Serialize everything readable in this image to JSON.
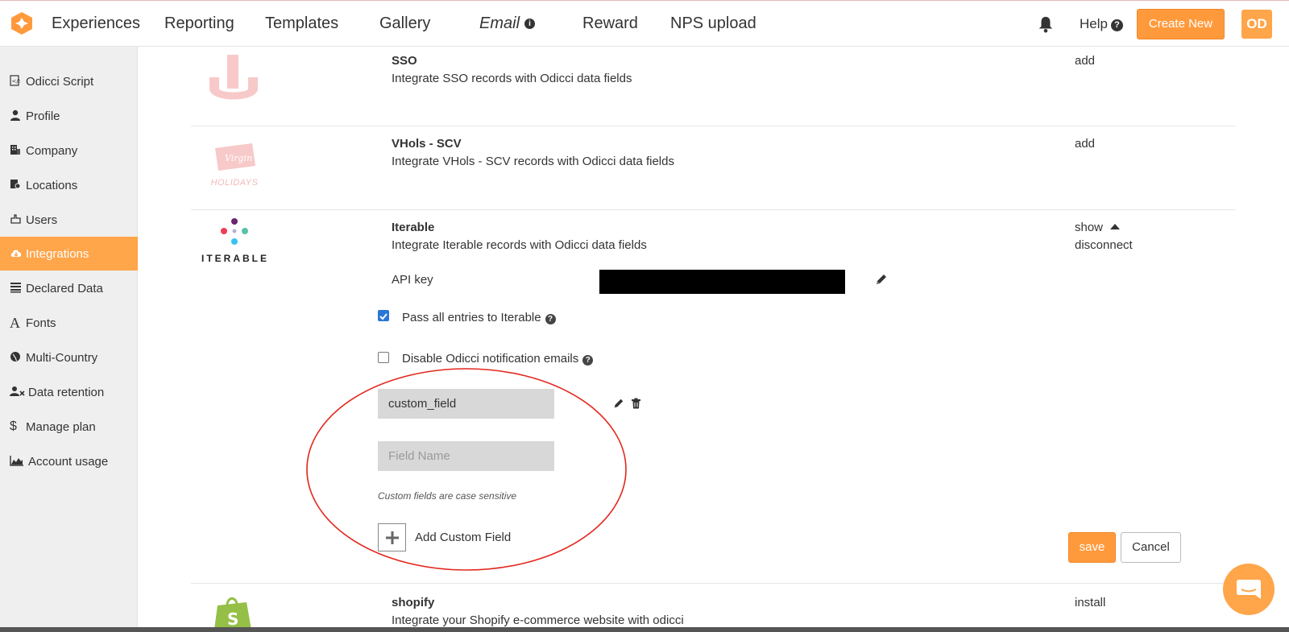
{
  "nav": {
    "items": [
      "Experiences",
      "Reporting",
      "Templates",
      "Gallery",
      "Email",
      "Reward",
      "NPS upload"
    ],
    "email_info_icon": "info-icon",
    "help_label": "Help",
    "create_new_label": "Create New",
    "avatar_initials": "OD",
    "accent_color": "#ff9a3c"
  },
  "sidebar": {
    "items": [
      {
        "label": "Odicci Script",
        "icon": "script-icon"
      },
      {
        "label": "Profile",
        "icon": "user-icon"
      },
      {
        "label": "Company",
        "icon": "building-icon"
      },
      {
        "label": "Locations",
        "icon": "map-pin-icon"
      },
      {
        "label": "Users",
        "icon": "users-icon"
      },
      {
        "label": "Integrations",
        "icon": "cloud-icon",
        "active": true
      },
      {
        "label": "Declared Data",
        "icon": "list-icon"
      },
      {
        "label": "Fonts",
        "icon": "font-icon"
      },
      {
        "label": "Multi-Country",
        "icon": "globe-icon"
      },
      {
        "label": "Data retention",
        "icon": "user-x-icon"
      },
      {
        "label": "Manage plan",
        "icon": "dollar-icon"
      },
      {
        "label": "Account usage",
        "icon": "chart-icon"
      }
    ]
  },
  "integrations": {
    "sso": {
      "title": "SSO",
      "desc": "Integrate SSO records with Odicci data fields",
      "action": "add"
    },
    "vhols": {
      "title": "VHols - SCV",
      "desc": "Integrate VHols - SCV records with Odicci data fields",
      "action": "add",
      "logo_line1": "Virgin",
      "logo_line2": "HOLIDAYS"
    },
    "iterable": {
      "title": "Iterable",
      "desc": "Integrate Iterable records with Odicci data fields",
      "show_label": "show",
      "disconnect_label": "disconnect",
      "logo_text": "ITERABLE",
      "api_key_label": "API key",
      "pass_all_label": "Pass all entries to Iterable",
      "pass_all_checked": true,
      "disable_notif_label": "Disable Odicci notification emails",
      "disable_notif_checked": false,
      "custom_field_value": "custom_field",
      "field_name_placeholder": "Field Name",
      "hint": "Custom fields are case sensitive",
      "add_custom_field_label": "Add Custom Field",
      "save_label": "save",
      "cancel_label": "Cancel"
    },
    "shopify": {
      "title": "shopify",
      "desc": "Integrate your Shopify e-commerce website with odicci",
      "action": "install"
    }
  }
}
